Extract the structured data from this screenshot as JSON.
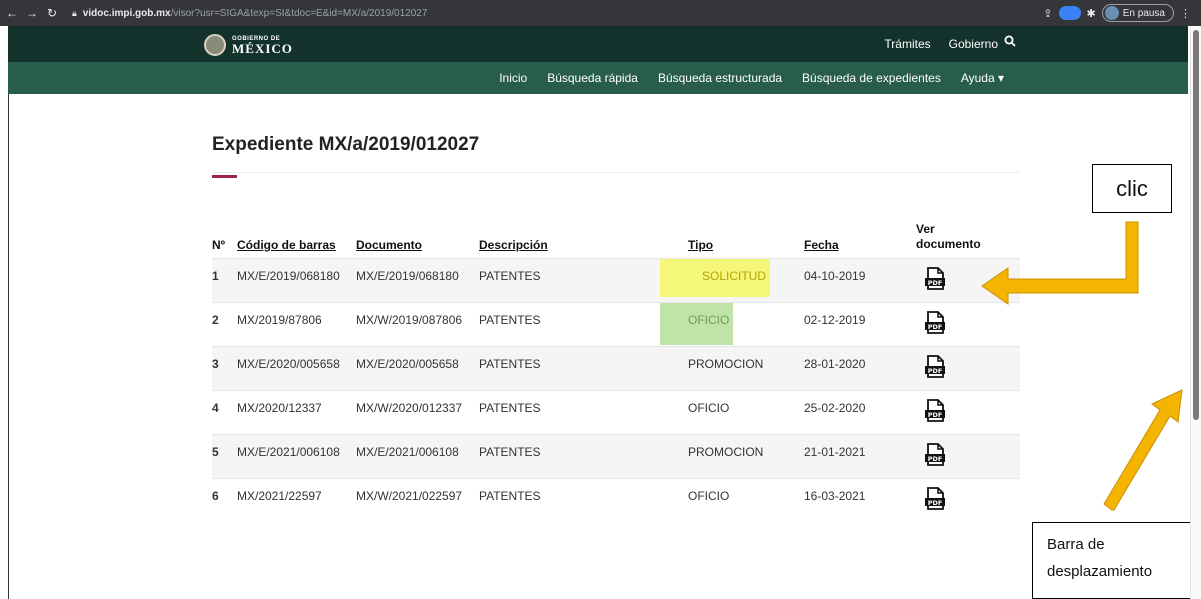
{
  "browser": {
    "url_domain": "vidoc.impi.gob.mx",
    "url_path": "/visor?usr=SIGA&texp=SI&tdoc=E&id=MX/a/2019/012027",
    "paused_label": "En pausa"
  },
  "header": {
    "logo_small": "GOBIERNO DE",
    "logo_big": "MÉXICO",
    "links": [
      "Trámites",
      "Gobierno"
    ]
  },
  "nav": {
    "items": [
      "Inicio",
      "Búsqueda rápida",
      "Búsqueda estructurada",
      "Búsqueda de expedientes",
      "Ayuda ▾"
    ]
  },
  "page": {
    "title": "Expediente MX/a/2019/012027"
  },
  "table": {
    "headers": {
      "n": "Nº",
      "code": "Código de barras",
      "doc": "Documento",
      "desc": "Descripción",
      "tipo": "Tipo",
      "fecha": "Fecha",
      "ver": "Ver documento"
    },
    "rows": [
      {
        "n": "1",
        "code": "MX/E/2019/068180",
        "doc": "MX/E/2019/068180",
        "desc": "PATENTES",
        "tipo": "SOLICITUD",
        "fecha": "04-10-2019"
      },
      {
        "n": "2",
        "code": "MX/2019/87806",
        "doc": "MX/W/2019/087806",
        "desc": "PATENTES",
        "tipo": "OFICIO",
        "fecha": "02-12-2019"
      },
      {
        "n": "3",
        "code": "MX/E/2020/005658",
        "doc": "MX/E/2020/005658",
        "desc": "PATENTES",
        "tipo": "PROMOCION",
        "fecha": "28-01-2020"
      },
      {
        "n": "4",
        "code": "MX/2020/12337",
        "doc": "MX/W/2020/012337",
        "desc": "PATENTES",
        "tipo": "OFICIO",
        "fecha": "25-02-2020"
      },
      {
        "n": "5",
        "code": "MX/E/2021/006108",
        "doc": "MX/E/2021/006108",
        "desc": "PATENTES",
        "tipo": "PROMOCION",
        "fecha": "21-01-2021"
      },
      {
        "n": "6",
        "code": "MX/2021/22597",
        "doc": "MX/W/2021/022597",
        "desc": "PATENTES",
        "tipo": "OFICIO",
        "fecha": "16-03-2021"
      }
    ]
  },
  "annotations": {
    "clic": "clic",
    "barra_line1": "Barra de",
    "barra_line2": "desplazamiento"
  },
  "colors": {
    "gov_dark": "#13322b",
    "gov_nav": "#285c4d",
    "accent": "#9d2449",
    "arrow": "#f5b400",
    "highlight_yellow": "#f4f77a",
    "highlight_green": "#bfe3a8"
  },
  "icons": {
    "back": "arrow-left-icon",
    "forward": "arrow-right-icon",
    "reload": "reload-icon",
    "lock": "lock-icon",
    "search": "search-icon",
    "pdf": "pdf-file-icon"
  }
}
